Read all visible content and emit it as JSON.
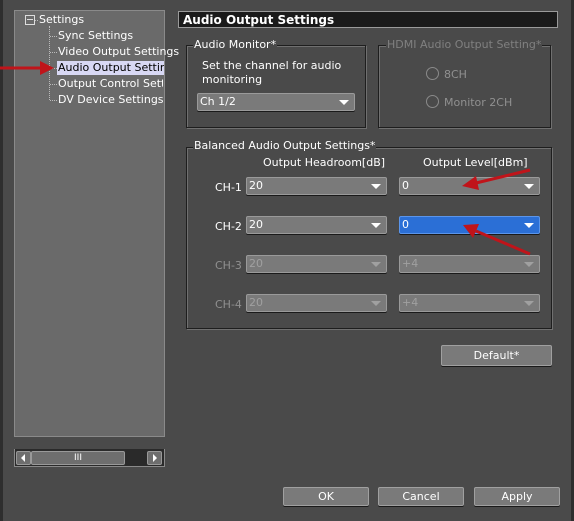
{
  "tree": {
    "root_label": "Settings",
    "items": [
      {
        "label": "Sync Settings",
        "selected": false
      },
      {
        "label": "Video Output Settings",
        "selected": false
      },
      {
        "label": "Audio Output Settings",
        "selected": true
      },
      {
        "label": "Output Control Settin",
        "selected": false
      },
      {
        "label": "DV Device Settings",
        "selected": false
      }
    ],
    "scroll_thumb_glyph": "III"
  },
  "panel": {
    "title": "Audio Output Settings",
    "audio_monitor": {
      "legend": "Audio Monitor*",
      "description_line1": "Set the channel for audio",
      "description_line2": "monitoring",
      "channel_value": "Ch 1/2"
    },
    "hdmi": {
      "legend": "HDMI Audio Output Setting*",
      "options": [
        "8CH",
        "Monitor 2CH"
      ],
      "enabled": false
    },
    "balanced": {
      "legend": "Balanced Audio Output Settings*",
      "col_headroom": "Output Headroom[dB]",
      "col_level": "Output Level[dBm]",
      "channels": [
        {
          "label": "CH-1",
          "headroom": "20",
          "level": "0",
          "enabled": true,
          "level_selected": false
        },
        {
          "label": "CH-2",
          "headroom": "20",
          "level": "0",
          "enabled": true,
          "level_selected": true
        },
        {
          "label": "CH-3",
          "headroom": "20",
          "level": "+4",
          "enabled": false,
          "level_selected": false
        },
        {
          "label": "CH-4",
          "headroom": "20",
          "level": "+4",
          "enabled": false,
          "level_selected": false
        }
      ]
    },
    "default_button": "Default*"
  },
  "footer": {
    "ok": "OK",
    "cancel": "Cancel",
    "apply": "Apply"
  },
  "annotation_color": "#c0141a"
}
